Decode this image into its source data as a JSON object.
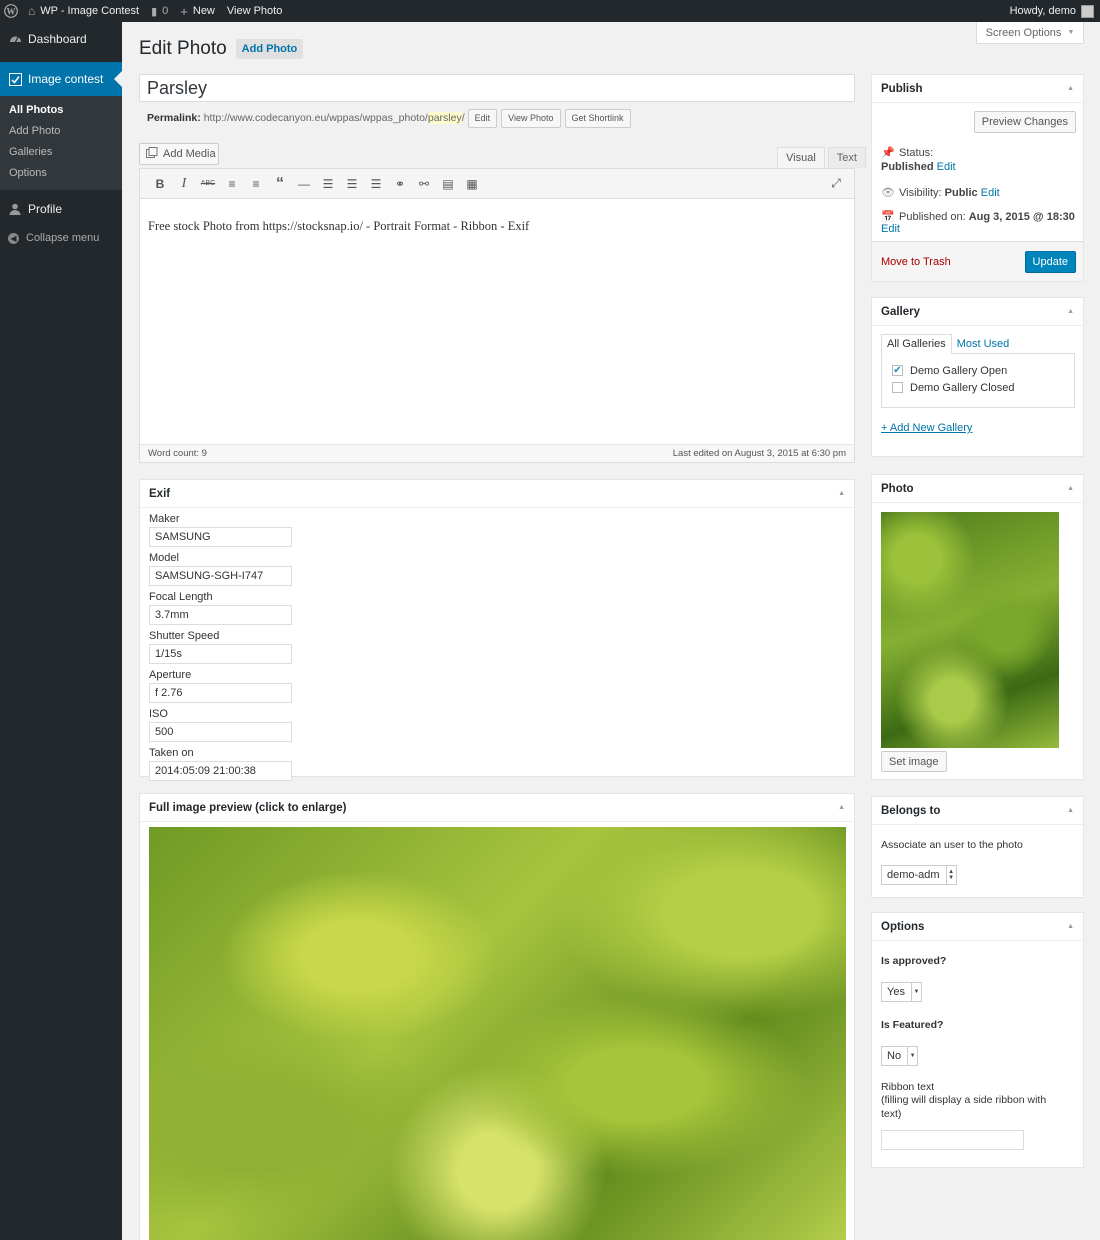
{
  "adminbar": {
    "site_name": "WP - Image Contest",
    "comments_count": "0",
    "new_label": "New",
    "view_label": "View Photo",
    "howdy": "Howdy, demo"
  },
  "sidebar": {
    "dashboard": "Dashboard",
    "image_contest": "Image contest",
    "submenu": [
      "All Photos",
      "Add Photo",
      "Galleries",
      "Options"
    ],
    "profile": "Profile",
    "collapse": "Collapse menu"
  },
  "page": {
    "title": "Edit Photo",
    "add_new": "Add Photo",
    "screen_options": "Screen Options"
  },
  "post": {
    "title": "Parsley",
    "permalink_label": "Permalink:",
    "permalink_base": "http://www.codecanyon.eu/wppas/wppas_photo/",
    "permalink_slug": "parsley",
    "permalink_end": "/",
    "edit_btn": "Edit",
    "view_btn": "View Photo",
    "shortlink_btn": "Get Shortlink"
  },
  "editor": {
    "add_media": "Add Media",
    "tab_visual": "Visual",
    "tab_text": "Text",
    "content": "Free stock Photo from https://stocksnap.io/ - Portrait Format - Ribbon - Exif",
    "word_count": "Word count: 9",
    "last_edited": "Last edited on August 3, 2015 at 6:30 pm",
    "toolbar_icons": [
      "bold-icon",
      "italic-icon",
      "strikethrough-icon",
      "bullet-list-icon",
      "numbered-list-icon",
      "blockquote-icon",
      "horizontal-line-icon",
      "align-left-icon",
      "align-center-icon",
      "align-right-icon",
      "link-icon",
      "unlink-icon",
      "read-more-icon",
      "toolbar-toggle-icon"
    ]
  },
  "exif": {
    "title": "Exif",
    "fields": [
      {
        "label": "Maker",
        "value": "SAMSUNG"
      },
      {
        "label": "Model",
        "value": "SAMSUNG-SGH-I747"
      },
      {
        "label": "Focal Length",
        "value": "3.7mm"
      },
      {
        "label": "Shutter Speed",
        "value": "1/15s"
      },
      {
        "label": "Aperture",
        "value": "f 2.76"
      },
      {
        "label": "ISO",
        "value": "500"
      },
      {
        "label": "Taken on",
        "value": "2014:05:09 21:00:38"
      }
    ]
  },
  "preview": {
    "title": "Full image preview (click to enlarge)"
  },
  "publish": {
    "title": "Publish",
    "preview_changes": "Preview Changes",
    "status_label": "Status:",
    "status_value": "Published",
    "edit": "Edit",
    "visibility_label": "Visibility:",
    "visibility_value": "Public",
    "published_label": "Published on:",
    "published_value": "Aug 3, 2015 @ 18:30",
    "trash": "Move to Trash",
    "update": "Update"
  },
  "gallery": {
    "title": "Gallery",
    "tab_all": "All Galleries",
    "tab_most": "Most Used",
    "items": [
      {
        "label": "Demo Gallery Open",
        "checked": true
      },
      {
        "label": "Demo Gallery Closed",
        "checked": false
      }
    ],
    "add_new": "+ Add New Gallery"
  },
  "photo": {
    "title": "Photo",
    "set_image": "Set image"
  },
  "belongs": {
    "title": "Belongs to",
    "label": "Associate an user to the photo",
    "user": "demo-adm"
  },
  "options": {
    "title": "Options",
    "approved_label": "Is approved?",
    "approved_value": "Yes",
    "featured_label": "Is Featured?",
    "featured_value": "No",
    "ribbon_label": "Ribbon text",
    "ribbon_help": "(filling will display a side ribbon with text)",
    "ribbon_value": ""
  }
}
